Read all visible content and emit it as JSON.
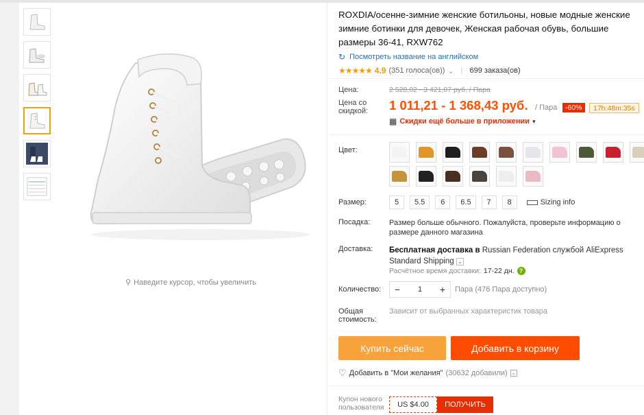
{
  "product": {
    "title": "ROXDIA/осенне-зимние женские ботильоны, новые модные женские зимние ботинки для девочек, Женская рабочая обувь, большие размеры 36-41, RXW762",
    "translate_link": "Посмотреть название на английском",
    "rating": "4.9",
    "votes": "(351 голоса(ов))",
    "orders": "699 заказа(ов)",
    "zoom_hint": "Наведите курсор, чтобы увеличить"
  },
  "price": {
    "label": "Цена:",
    "old": "2 528,02 - 3 421,07 руб. / Пара",
    "discount_label": "Цена со скидкой:",
    "current": "1 011,21 - 1 368,43 руб.",
    "per": "/ Пара",
    "discount_badge": "-60%",
    "timer": "17h:48m:35s",
    "app_promo": "Скидки ещё больше в приложении"
  },
  "labels": {
    "color": "Цвет:",
    "size": "Размер:",
    "fit": "Посадка:",
    "delivery": "Доставка:",
    "quantity": "Количество:",
    "total": "Общая стоимость:"
  },
  "colors": [
    {
      "name": "white",
      "hex": "#f4f4f4"
    },
    {
      "name": "wheat",
      "hex": "#e0962a"
    },
    {
      "name": "black",
      "hex": "#1e1e1e"
    },
    {
      "name": "brown",
      "hex": "#6a3d24"
    },
    {
      "name": "dark-brown",
      "hex": "#7a5240"
    },
    {
      "name": "light-grey",
      "hex": "#e6e6ea"
    },
    {
      "name": "pink",
      "hex": "#f2c2d2"
    },
    {
      "name": "olive",
      "hex": "#4c5a3a"
    },
    {
      "name": "red",
      "hex": "#c8202e"
    },
    {
      "name": "beige",
      "hex": "#d8d0b8"
    },
    {
      "name": "tan",
      "hex": "#c7923c"
    },
    {
      "name": "black-fur",
      "hex": "#222222"
    },
    {
      "name": "coffee",
      "hex": "#4a2e22"
    },
    {
      "name": "dark-grey",
      "hex": "#4a4440"
    },
    {
      "name": "white-fur",
      "hex": "#eeeeee"
    },
    {
      "name": "pink-fur",
      "hex": "#e9b9c4"
    }
  ],
  "sizes": [
    "5",
    "5.5",
    "6",
    "6.5",
    "7",
    "8"
  ],
  "sizing_info": "Sizing info",
  "fit_text": "Размер больше обычного. Пожалуйста, проверьте информацию о размере данного магазина",
  "delivery": {
    "bold": "Бесплатная доставка в",
    "rest": " Russian Federation службой AliExpress Standard Shipping",
    "time_label": "Расчётное время доставки:",
    "time_value": "17-22 дн."
  },
  "quantity": {
    "value": "1",
    "minus": "−",
    "plus": "+",
    "note": "Пара (476 Пара доступно)"
  },
  "total_note": "Зависит от выбранных характеристик товара",
  "buttons": {
    "buy": "Купить сейчас",
    "cart": "Добавить в корзину"
  },
  "wishlist": {
    "label": "Добавить в \"Мои желания\"",
    "count": "(30632 добавили)"
  },
  "coupon": {
    "label": "Купон нового пользователя",
    "amount": "US $4.00",
    "get": "ПОЛУЧИТЬ"
  },
  "accent": "#ff4f00"
}
